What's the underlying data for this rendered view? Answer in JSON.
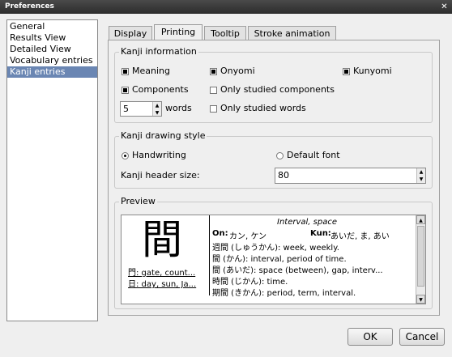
{
  "window": {
    "title": "Preferences",
    "close_glyph": "✕"
  },
  "categories": [
    "General",
    "Results View",
    "Detailed View",
    "Vocabulary entries",
    "Kanji entries"
  ],
  "selected_category": "Kanji entries",
  "tabs": [
    {
      "label": "Display",
      "active": false
    },
    {
      "label": "Printing",
      "active": true
    },
    {
      "label": "Tooltip",
      "active": false
    },
    {
      "label": "Stroke animation",
      "active": false
    }
  ],
  "kanji_information": {
    "title": "Kanji information",
    "meaning": {
      "label": "Meaning",
      "checked": true
    },
    "onyomi": {
      "label": "Onyomi",
      "checked": true
    },
    "kunyomi": {
      "label": "Kunyomi",
      "checked": true
    },
    "components": {
      "label": "Components",
      "checked": true
    },
    "only_studied_components": {
      "label": "Only studied components",
      "checked": false
    },
    "words_count": "5",
    "words_label": "words",
    "only_studied_words": {
      "label": "Only studied words",
      "checked": false
    }
  },
  "drawing_style": {
    "title": "Kanji drawing style",
    "handwriting": {
      "label": "Handwriting",
      "checked": true
    },
    "default_font": {
      "label": "Default font",
      "checked": false
    },
    "header_size_label": "Kanji header size:",
    "header_size_value": "80"
  },
  "preview": {
    "title": "Preview",
    "kanji": "間",
    "components": [
      "門: gate, count...",
      "日: day, sun, Ja..."
    ],
    "meaning": "Interval, space",
    "on_label": "On:",
    "on_value": "カン, ケン",
    "kun_label": "Kun:",
    "kun_value": "あいだ, ま, あい",
    "words": [
      "週間 (しゅうかん): week, weekly.",
      "間 (かん): interval, period of time.",
      "間 (あいだ): space (between), gap, interv...",
      "時間 (じかん): time.",
      "期間 (きかん): period, term, interval."
    ]
  },
  "buttons": {
    "ok": "OK",
    "cancel": "Cancel"
  }
}
